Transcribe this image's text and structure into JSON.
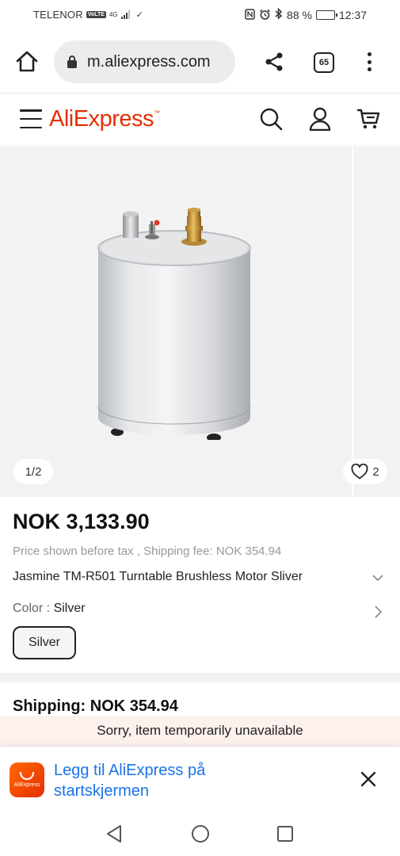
{
  "status_bar": {
    "carrier": "TELENOR",
    "volte": "VoLTE",
    "network": "4G",
    "battery_text": "88 %",
    "battery_level": 0.88,
    "time": "12:37"
  },
  "browser": {
    "url": "m.aliexpress.com",
    "tab_count": "65"
  },
  "header": {
    "logo": "AliExpress"
  },
  "gallery": {
    "counter": "1/2",
    "wishlist_count": "2"
  },
  "product": {
    "price": "NOK 3,133.90",
    "tax_note": "Price shown before tax , Shipping fee: NOK 354.94",
    "title": "Jasmine TM-R501 Turntable Brushless Motor Sliver",
    "color_label": "Color",
    "color_value": "Silver",
    "color_option": "Silver"
  },
  "shipping": {
    "label": "Shipping: NOK 354.94",
    "unavailable": "Sorry, item temporarily unavailable"
  },
  "install_banner": {
    "app_icon_text": "AliExpress",
    "text": "Legg til AliExpress på startskjermen"
  },
  "colors": {
    "brand": "#e62e04",
    "link": "#1a73e8",
    "banner_bg": "#fdf1ee"
  }
}
